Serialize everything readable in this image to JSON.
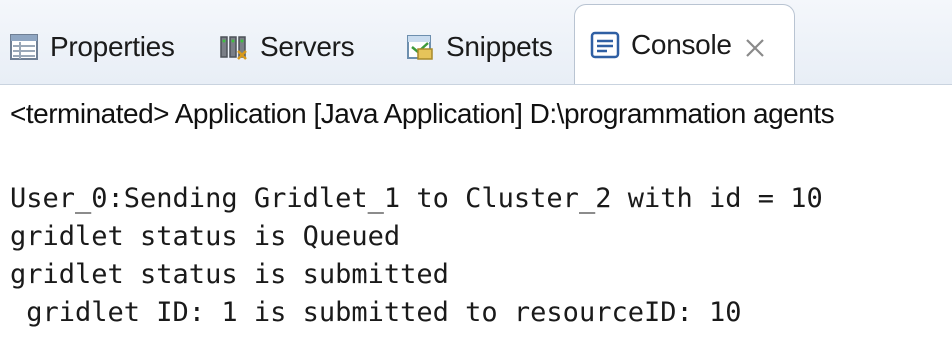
{
  "tabs": {
    "properties": {
      "label": "Properties",
      "icon": "properties-icon"
    },
    "servers": {
      "label": "Servers",
      "icon": "servers-icon"
    },
    "snippets": {
      "label": "Snippets",
      "icon": "snippets-icon"
    },
    "console": {
      "label": "Console",
      "icon": "console-icon",
      "active": true,
      "close_icon": "close-icon"
    }
  },
  "console": {
    "status_line": "<terminated> Application [Java Application] D:\\programmation agents",
    "output_lines": [
      "User_0:Sending Gridlet_1 to Cluster_2 with id = 10",
      "gridlet status is Queued",
      "gridlet status is submitted",
      " gridlet ID: 1 is submitted to resourceID: 10"
    ]
  },
  "colors": {
    "tabbar_bg": "#e8eef6",
    "active_tab_bg": "#ffffff",
    "text": "#1b1b1b"
  }
}
